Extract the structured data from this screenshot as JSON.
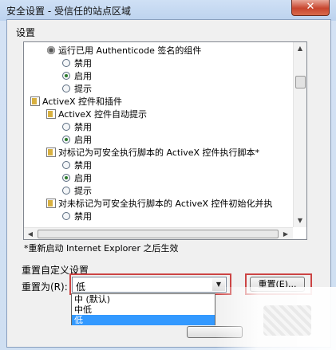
{
  "window": {
    "title": "安全设置 - 受信任的站点区域",
    "close_glyph": "✕"
  },
  "settings": {
    "group_label": "设置",
    "rows": [
      {
        "kind": "setting",
        "icon": "gear-icon",
        "indent": 1,
        "label": "运行已用 Authenticode 签名的组件"
      },
      {
        "kind": "option",
        "indent": 2,
        "label": "禁用",
        "checked": false
      },
      {
        "kind": "option",
        "indent": 2,
        "label": "启用",
        "checked": true
      },
      {
        "kind": "option",
        "indent": 2,
        "label": "提示",
        "checked": false
      },
      {
        "kind": "category",
        "icon": "document-icon",
        "indent": 0,
        "label": "ActiveX 控件和插件"
      },
      {
        "kind": "setting",
        "icon": "document-icon",
        "indent": 1,
        "label": "ActiveX 控件自动提示"
      },
      {
        "kind": "option",
        "indent": 2,
        "label": "禁用",
        "checked": false
      },
      {
        "kind": "option",
        "indent": 2,
        "label": "启用",
        "checked": true
      },
      {
        "kind": "setting",
        "icon": "document-icon",
        "indent": 1,
        "label": "对标记为可安全执行脚本的 ActiveX 控件执行脚本*"
      },
      {
        "kind": "option",
        "indent": 2,
        "label": "禁用",
        "checked": false
      },
      {
        "kind": "option",
        "indent": 2,
        "label": "启用",
        "checked": true
      },
      {
        "kind": "option",
        "indent": 2,
        "label": "提示",
        "checked": false
      },
      {
        "kind": "setting",
        "icon": "document-icon",
        "indent": 1,
        "label": "对未标记为可安全执行脚本的 ActiveX 控件初始化并执"
      },
      {
        "kind": "option",
        "indent": 2,
        "label": "禁用",
        "checked": false
      }
    ],
    "note": "*重新启动 Internet Explorer 之后生效"
  },
  "reset": {
    "group_label": "重置自定义设置",
    "reset_to_label": "重置为(R):",
    "selected": "低",
    "button_label": "重置(E)...",
    "options": [
      {
        "label": "中 (默认)",
        "selected": false
      },
      {
        "label": "中低",
        "selected": false
      },
      {
        "label": "低",
        "selected": true
      }
    ]
  },
  "colors": {
    "highlight_box": "#cc4444",
    "selection": "#3399ff"
  }
}
